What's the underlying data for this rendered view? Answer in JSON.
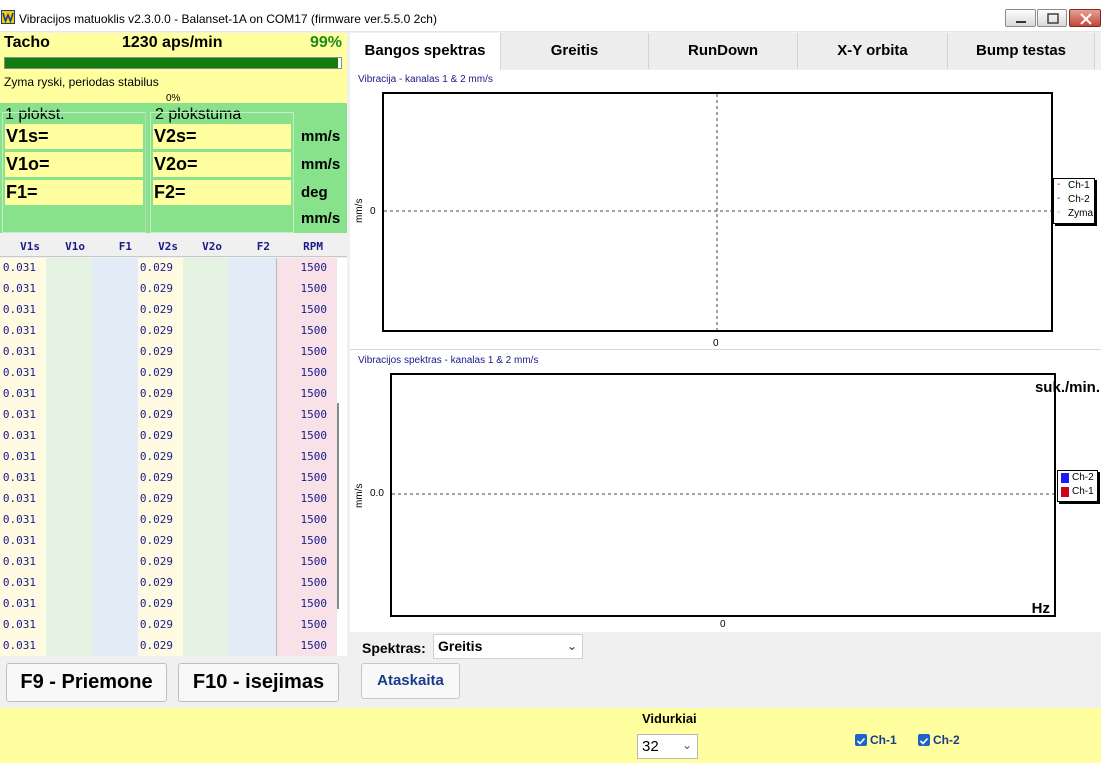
{
  "window": {
    "title": "Vibracijos matuoklis v2.3.0.0 - Balanset-1A on COM17 (firmware ver.5.5.0 2ch)",
    "icon": "vm-app-icon"
  },
  "tacho": {
    "label": "Tacho",
    "value": "1230 aps/min",
    "percent_text": "99%",
    "progress": 0.99,
    "status": "Zyma ryski, periodas stabilus",
    "secondary_percent": "0%"
  },
  "planes": {
    "plane1_title": "1 plokst.",
    "plane2_title": "2 plokstuma",
    "v1s": "V1s=",
    "v1o": "V1o=",
    "f1": "F1=",
    "v2s": "V2s=",
    "v2o": "V2o=",
    "f2": "F2=",
    "units": [
      "mm/s",
      "mm/s",
      "deg",
      "mm/s"
    ]
  },
  "grid": {
    "columns": [
      "V1s",
      "V1o",
      "F1",
      "V2s",
      "V2o",
      "F2",
      "RPM"
    ],
    "rows": [
      [
        "0.031",
        "",
        "",
        "0.029",
        "",
        "",
        "1500"
      ],
      [
        "0.031",
        "",
        "",
        "0.029",
        "",
        "",
        "1500"
      ],
      [
        "0.031",
        "",
        "",
        "0.029",
        "",
        "",
        "1500"
      ],
      [
        "0.031",
        "",
        "",
        "0.029",
        "",
        "",
        "1500"
      ],
      [
        "0.031",
        "",
        "",
        "0.029",
        "",
        "",
        "1500"
      ],
      [
        "0.031",
        "",
        "",
        "0.029",
        "",
        "",
        "1500"
      ],
      [
        "0.031",
        "",
        "",
        "0.029",
        "",
        "",
        "1500"
      ],
      [
        "0.031",
        "",
        "",
        "0.029",
        "",
        "",
        "1500"
      ],
      [
        "0.031",
        "",
        "",
        "0.029",
        "",
        "",
        "1500"
      ],
      [
        "0.031",
        "",
        "",
        "0.029",
        "",
        "",
        "1500"
      ],
      [
        "0.031",
        "",
        "",
        "0.029",
        "",
        "",
        "1500"
      ],
      [
        "0.031",
        "",
        "",
        "0.029",
        "",
        "",
        "1500"
      ],
      [
        "0.031",
        "",
        "",
        "0.029",
        "",
        "",
        "1500"
      ],
      [
        "0.031",
        "",
        "",
        "0.029",
        "",
        "",
        "1500"
      ],
      [
        "0.031",
        "",
        "",
        "0.029",
        "",
        "",
        "1500"
      ],
      [
        "0.031",
        "",
        "",
        "0.029",
        "",
        "",
        "1500"
      ],
      [
        "0.031",
        "",
        "",
        "0.029",
        "",
        "",
        "1500"
      ],
      [
        "0.031",
        "",
        "",
        "0.029",
        "",
        "",
        "1500"
      ],
      [
        "0.031",
        "",
        "",
        "0.029",
        "",
        "",
        "1500"
      ]
    ]
  },
  "buttons": {
    "f9": "F9 - Priemone",
    "f10": "F10 - isejimas",
    "report": "Ataskaita"
  },
  "tabs": [
    "Bangos spektras",
    "Greitis",
    "RunDown",
    "X-Y orbita",
    "Bump testas"
  ],
  "active_tab": 0,
  "colors": {
    "accent": "#ff9d5c",
    "panel_yellow": "#ffff9f",
    "panel_green": "#88e28c",
    "ch1": "#d0021b",
    "ch2": "#1a1aff",
    "zyma": "#e08aa0"
  },
  "chart_data": [
    {
      "type": "line",
      "title": "Vibracija  - kanalas 1 & 2 mm/s",
      "xlabel": "",
      "ylabel": "mm/s",
      "x_ticks": [
        "0"
      ],
      "y_ticks": [
        "0"
      ],
      "series": [
        {
          "name": "Ch-1",
          "values": []
        },
        {
          "name": "Ch-2",
          "values": []
        },
        {
          "name": "Zyma",
          "values": []
        }
      ],
      "grid": true,
      "legend": "right"
    },
    {
      "type": "bar",
      "title": "Vibracijos spektras  - kanalas 1 & 2 mm/s",
      "xlabel": "Hz",
      "ylabel": "mm/s",
      "annotation": "suk./min.",
      "x_ticks": [
        "0"
      ],
      "y_ticks": [
        "0.0"
      ],
      "series": [
        {
          "name": "Ch-2",
          "values": []
        },
        {
          "name": "Ch-1",
          "values": []
        }
      ],
      "grid": true,
      "legend": "right"
    }
  ],
  "spectras": {
    "label": "Spektras:",
    "selected": "Greitis"
  },
  "averages": {
    "label": "Vidurkiai",
    "selected": "32"
  },
  "channels": [
    {
      "label": "Ch-1",
      "checked": true
    },
    {
      "label": "Ch-2",
      "checked": true
    }
  ]
}
